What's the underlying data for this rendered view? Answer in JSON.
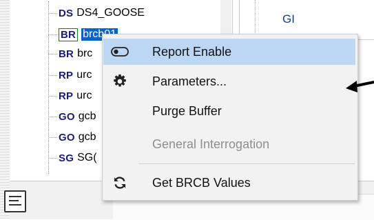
{
  "tree": {
    "items": [
      {
        "tag": "DS",
        "label": "DS4_GOOSE"
      },
      {
        "tag": "BR",
        "label": "brcb01"
      },
      {
        "tag": "BR",
        "label": "brc"
      },
      {
        "tag": "RP",
        "label": "urc"
      },
      {
        "tag": "RP",
        "label": "urc"
      },
      {
        "tag": "GO",
        "label": "gcb"
      },
      {
        "tag": "GO",
        "label": "gcb"
      },
      {
        "tag": "SG",
        "label": "SG("
      }
    ]
  },
  "right_panel": {
    "gi": "GI"
  },
  "context_menu": {
    "items": [
      {
        "label": "Report Enable",
        "icon": "toggle-icon",
        "enabled": true
      },
      {
        "label": "Parameters...",
        "icon": "gear-icon",
        "enabled": true
      },
      {
        "label": "Purge Buffer",
        "icon": "",
        "enabled": true
      },
      {
        "label": "General Interrogation",
        "icon": "",
        "enabled": false
      },
      {
        "label": "Get BRCB Values",
        "icon": "refresh-icon",
        "enabled": true
      }
    ]
  },
  "colors": {
    "selection": "#0a62c8",
    "menu_highlight": "#bcd7f4",
    "tag_text": "#1a1a7a",
    "gi_text": "#0a3fa0"
  }
}
